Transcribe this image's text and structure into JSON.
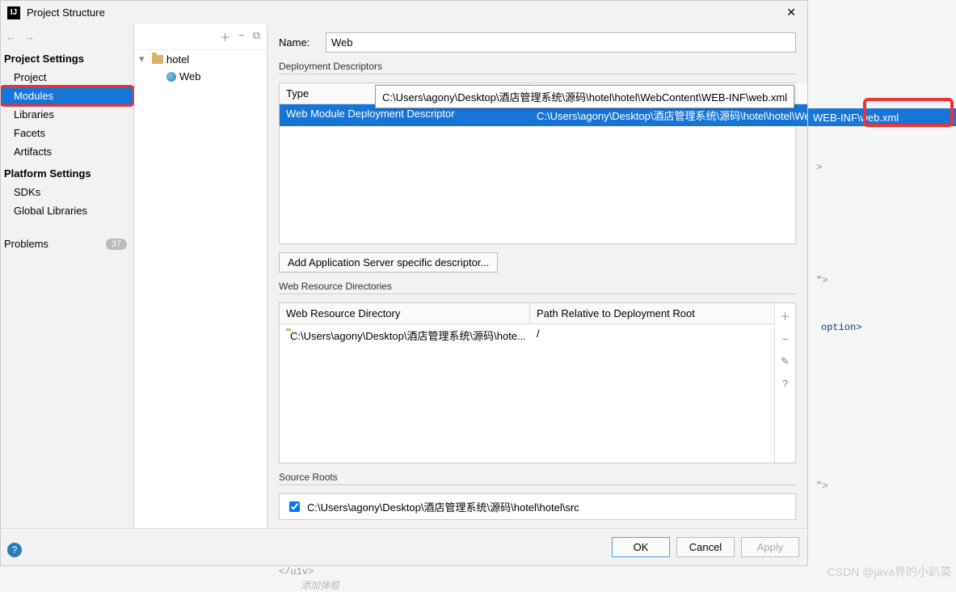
{
  "title": "Project Structure",
  "nav": {
    "settings_header": "Project Settings",
    "items1": [
      "Project",
      "Modules",
      "Libraries",
      "Facets",
      "Artifacts"
    ],
    "platform_header": "Platform Settings",
    "items2": [
      "SDKs",
      "Global Libraries"
    ],
    "problems_label": "Problems",
    "problems_count": "37"
  },
  "tree": {
    "root": "hotel",
    "child": "Web"
  },
  "form": {
    "name_label": "Name:",
    "name_value": "Web",
    "deploy_label": "Deployment Descriptors",
    "th_type": "Type",
    "selected_row_type": "Web Module Deployment Descriptor",
    "selected_row_path": "C:\\Users\\agony\\Desktop\\酒店管理系统\\源码\\hotel\\hotel\\WebContent\\WEB-INF\\web.xml",
    "tooltip_path": "C:\\Users\\agony\\Desktop\\酒店管理系统\\源码\\hotel\\hotel\\WebContent\\WEB-INF\\web.xml",
    "overflow_text": "WEB-INF\\web.xml",
    "add_descriptor_btn": "Add Application Server specific descriptor...",
    "webres_label": "Web Resource Directories",
    "th_wrd": "Web Resource Directory",
    "th_path_rel": "Path Relative to Deployment Root",
    "wrd_row_dir": "C:\\Users\\agony\\Desktop\\酒店管理系统\\源码\\hote...",
    "wrd_row_path": "/",
    "source_roots_label": "Source Roots",
    "source_root_value": "C:\\Users\\agony\\Desktop\\酒店管理系统\\源码\\hotel\\hotel\\src"
  },
  "buttons": {
    "ok": "OK",
    "cancel": "Cancel",
    "apply": "Apply"
  },
  "bgcode": {
    "c1": "\">",
    "c2": "option>",
    "c3": "\">",
    "c4": "</u1v>",
    "c5": "添加弹框"
  },
  "watermark": "CSDN @java界的小趴菜"
}
